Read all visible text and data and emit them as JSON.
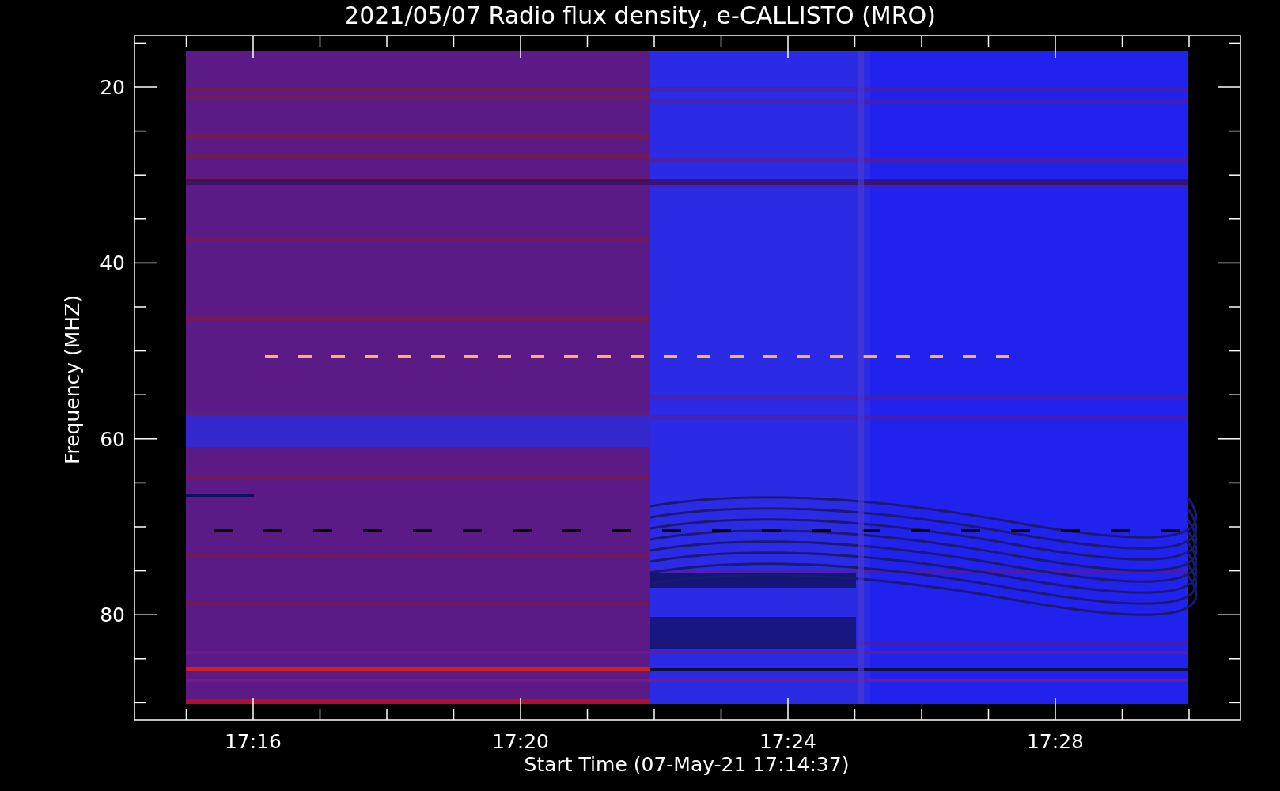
{
  "title": "2021/05/07  Radio flux density, e-CALLISTO (MRO)",
  "y_axis": {
    "label": "Frequency (MHZ)",
    "ticks": [
      "20",
      "40",
      "60",
      "80"
    ]
  },
  "x_axis": {
    "label": "Start Time (07-May-21 17:14:37)",
    "ticks": [
      "17:16",
      "17:20",
      "17:24",
      "17:28"
    ]
  }
}
